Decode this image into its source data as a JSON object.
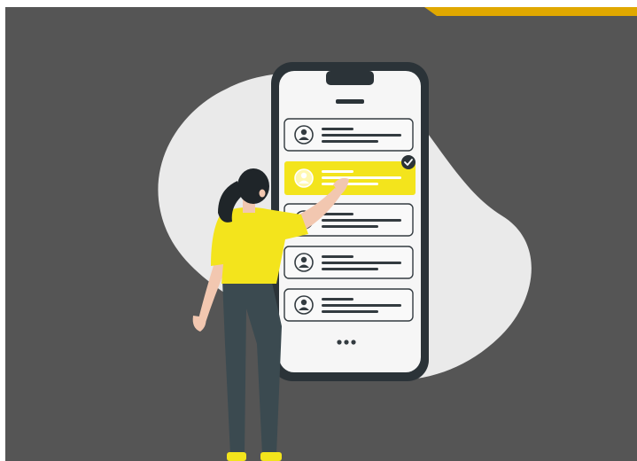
{
  "illustration": {
    "subject": "list-selection",
    "colors": {
      "background": "#555555",
      "blob": "#eaeaea",
      "phone_frame": "#2b3338",
      "phone_screen": "#f6f6f6",
      "accent_yellow": "#f3e41c",
      "pants": "#3b4a50",
      "hair": "#1f2529",
      "skin": "#f2c7b0",
      "corner_gold": "#e0a800"
    },
    "list_items": [
      {
        "selected": false
      },
      {
        "selected": true
      },
      {
        "selected": false
      },
      {
        "selected": false
      },
      {
        "selected": false
      }
    ],
    "icons": [
      "avatar-icon",
      "check-icon",
      "more-dots-icon"
    ]
  }
}
